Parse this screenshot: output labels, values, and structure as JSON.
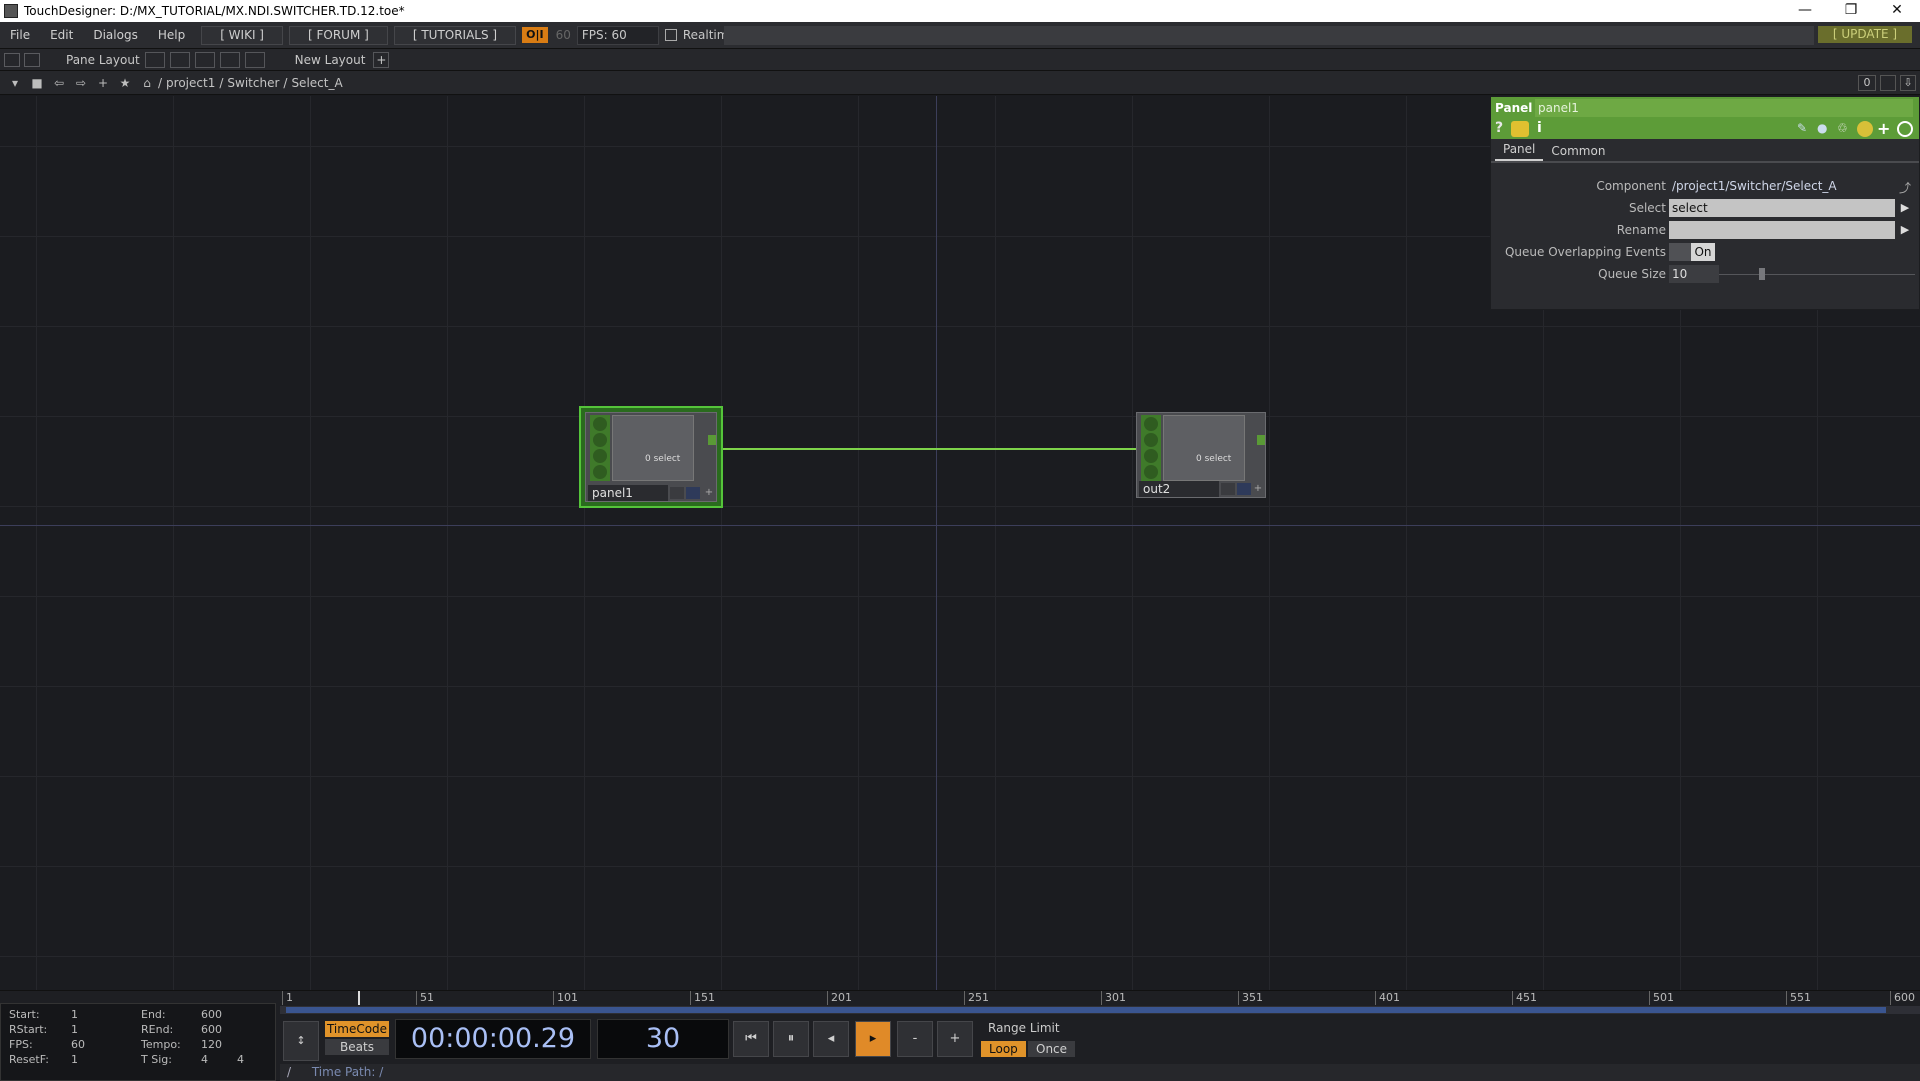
{
  "window": {
    "title": "TouchDesigner: D:/MX_TUTORIAL/MX.NDI.SWITCHER.TD.12.toe*",
    "minimize": "—",
    "restore": "❐",
    "close": "✕"
  },
  "menu": {
    "items": [
      "File",
      "Edit",
      "Dialogs",
      "Help"
    ],
    "wiki": "[ WIKI ]",
    "forum": "[ FORUM ]",
    "tutorials": "[ TUTORIALS ]",
    "oi": "O|I",
    "fps_target": "60",
    "fps_label": "FPS:",
    "fps_value": "60",
    "realtime": "Realtime",
    "update": "[ UPDATE ]"
  },
  "toolbar2": {
    "pane_layout": "Pane Layout",
    "new_layout": "New Layout",
    "plus": "+"
  },
  "pathbar": {
    "crumbs": [
      "project1",
      "Switcher",
      "Select_A"
    ],
    "counter": "0"
  },
  "nodes": [
    {
      "name": "panel1",
      "viewer_text": "0 select",
      "selected": true
    },
    {
      "name": "out2",
      "viewer_text": "0 select",
      "selected": false
    }
  ],
  "param_panel": {
    "type": "Panel",
    "name": "panel1",
    "tabs": [
      "Panel",
      "Common"
    ],
    "params": [
      {
        "label": "Component",
        "value": "/project1/Switcher/Select_A"
      },
      {
        "label": "Select",
        "value": "select"
      },
      {
        "label": "Rename",
        "value": ""
      },
      {
        "label": "Queue Overlapping Events",
        "value": "On"
      },
      {
        "label": "Queue Size",
        "value": "10"
      }
    ]
  },
  "timeline": {
    "stats": {
      "start_label": "Start:",
      "start": "1",
      "end_label": "End:",
      "end": "600",
      "rstart_label": "RStart:",
      "rstart": "1",
      "rend_label": "REnd:",
      "rend": "600",
      "fps_label": "FPS:",
      "fps": "60",
      "tempo_label": "Tempo:",
      "tempo": "120",
      "resetf_label": "ResetF:",
      "resetf": "1",
      "tsig_label": "T Sig:",
      "tsig_a": "4",
      "tsig_b": "4"
    },
    "ruler": [
      "1",
      "51",
      "101",
      "151",
      "201",
      "251",
      "301",
      "351",
      "401",
      "451",
      "501",
      "551",
      "600"
    ],
    "timecode_btn": "TimeCode",
    "beats_btn": "Beats",
    "timecode": "00:00:00.29",
    "frame": "30",
    "range_limit": "Range Limit",
    "loop": "Loop",
    "once": "Once",
    "time_path_label": "Time Path: /",
    "minus": "-",
    "plus": "+"
  }
}
